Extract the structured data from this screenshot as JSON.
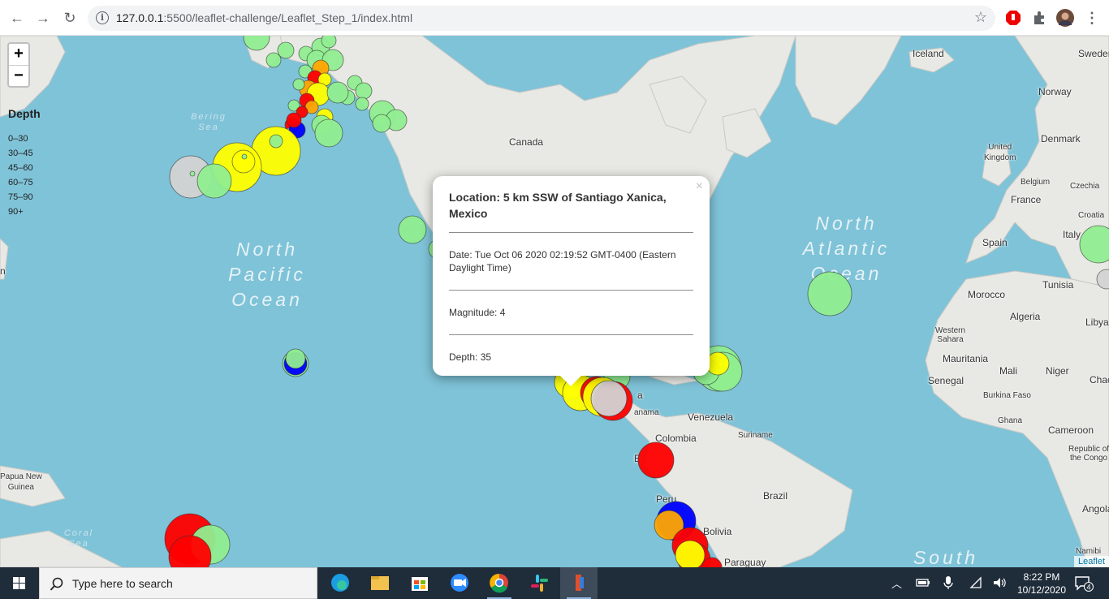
{
  "browser": {
    "url_host": "127.0.0.1",
    "url_path": ":5500/leaflet-challenge/Leaflet_Step_1/index.html"
  },
  "map": {
    "zoom_in": "+",
    "zoom_out": "−",
    "legend": {
      "title": "Depth",
      "ranges": [
        "0–30",
        "30–45",
        "45–60",
        "60–75",
        "75–90",
        "90+"
      ]
    },
    "oceans": {
      "north_pacific": "North\nPacific\nOcean",
      "north_atlantic": "North\nAtlantic\nOcean",
      "bering_sea": "Bering\nSea",
      "coral_sea": "Coral\nSea",
      "south": "South"
    },
    "places": {
      "iceland": "Iceland",
      "sweden": "Sweder",
      "norway": "Norway",
      "canada": "Canada",
      "united_kingdom": "United\nKingdom",
      "denmark": "Denmark",
      "belgium": "Belgium",
      "czechia": "Czechia",
      "france": "France",
      "croatia": "Croatia",
      "spain": "Spain",
      "italy": "Italy",
      "morocco": "Morocco",
      "tunisia": "Tunisia",
      "algeria": "Algeria",
      "libya": "Libya",
      "western_sahara": "Western\nSahara",
      "mauritania": "Mauritania",
      "mali": "Mali",
      "niger": "Niger",
      "chad": "Chac",
      "senegal": "Senegal",
      "burkina_faso": "Burkina Faso",
      "ghana": "Ghana",
      "cameroon": "Cameroon",
      "republic_congo": "Republic of\nthe Congo",
      "venezuela": "Venezuela",
      "suriname": "Suriname",
      "colombia": "Colombia",
      "panama": "anama",
      "ecuador": "E",
      "peru": "Peru",
      "brazil": "Brazil",
      "bolivia": "Bolivia",
      "paraguay": "Paraguay",
      "angola": "Angola",
      "namibia": "Namibi",
      "papua": "Papua New\nGuinea",
      "n_edge": "n",
      "america_partial": "a"
    },
    "popup": {
      "location": "Location: 5 km SSW of Santiago Xanica, Mexico",
      "date": "Date: Tue Oct 06 2020 02:19:52 GMT-0400 (Eastern Daylight Time)",
      "magnitude": "Magnitude: 4",
      "depth": "Depth: 35",
      "close": "×"
    },
    "attribution": "Leaflet",
    "colors": {
      "d0_30": "#90ee90",
      "d30_45": "#ffff00",
      "d45_60": "#ffa500",
      "d60_75": "#ff0000",
      "d75_90": "#0000ff",
      "d90_plus": "#d3d3d3"
    }
  },
  "taskbar": {
    "search_placeholder": "Type here to search",
    "time": "8:22 PM",
    "date": "10/12/2020",
    "notifications": "4"
  }
}
